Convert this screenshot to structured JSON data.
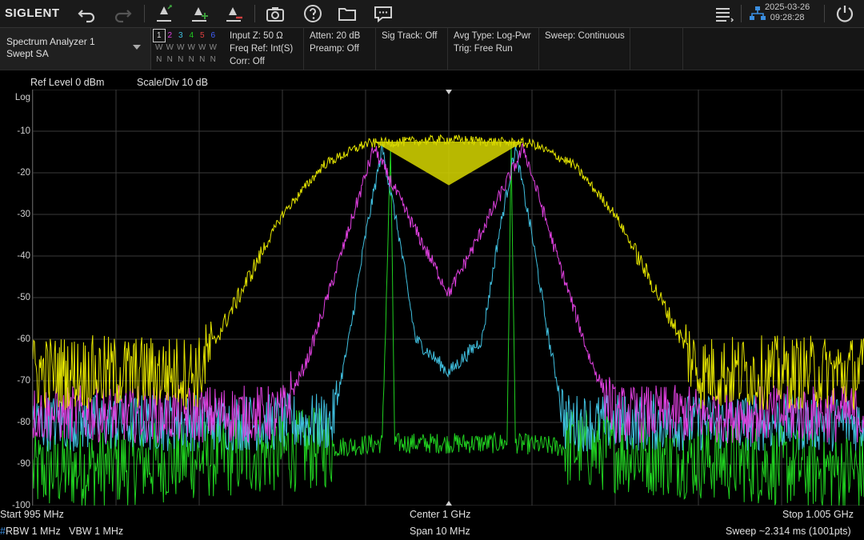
{
  "brand": "SIGLENT",
  "datetime": {
    "date": "2025-03-26",
    "time": "09:28:28"
  },
  "toolbar": {
    "icons": [
      "undo-icon",
      "redo-icon",
      "peak-marker-icon",
      "marker-add-icon",
      "marker-delete-icon",
      "screenshot-icon",
      "help-icon",
      "folder-icon",
      "message-icon",
      "menu-list-icon",
      "network-icon",
      "power-icon"
    ]
  },
  "mode": {
    "name": "Spectrum Analyzer 1",
    "sub": "Swept SA"
  },
  "traces": {
    "numbers": [
      "1",
      "2",
      "3",
      "4",
      "5",
      "6"
    ],
    "types": [
      "W",
      "W",
      "W",
      "W",
      "W",
      "W"
    ],
    "detectors": [
      "N",
      "N",
      "N",
      "N",
      "N",
      "N"
    ],
    "colors": [
      "#e5e500",
      "#e040e0",
      "#40c0e0",
      "#20d020",
      "#e04040",
      "#4060ff"
    ]
  },
  "info": {
    "input_z": "Input Z: 50 Ω",
    "freq_ref": "Freq Ref: Int(S)",
    "corr": "Corr: Off",
    "atten": "Atten: 20 dB",
    "preamp": "Preamp: Off",
    "sig_track": "Sig Track: Off",
    "avg_type": "Avg Type: Log-Pwr",
    "trig": "Trig: Free Run",
    "sweep_mode": "Sweep: Continuous"
  },
  "plot_header": {
    "ref_level": "Ref Level  0 dBm",
    "scale": "Scale/Div  10 dB"
  },
  "y_axis": {
    "scale_label": "Log",
    "ticks": [
      "-10",
      "-20",
      "-30",
      "-40",
      "-50",
      "-60",
      "-70",
      "-80",
      "-90",
      "-100"
    ]
  },
  "footer": {
    "start": "Start  995 MHz",
    "center": "Center  1 GHz",
    "stop": "Stop  1.005 GHz",
    "rbw": "RBW  1 MHz",
    "vbw": "VBW  1 MHz",
    "span": "Span  10 MHz",
    "sweep": "Sweep  ~2.314 ms (1001pts)"
  },
  "chart_data": {
    "type": "line",
    "xlabel": "",
    "ylabel": "",
    "x_range_mhz": [
      995,
      1005
    ],
    "ylim": [
      -100,
      0
    ],
    "series": [
      {
        "color": "#e5e500",
        "description_points": [
          [
            995,
            -68
          ],
          [
            997,
            -68
          ],
          [
            997.2,
            -60
          ],
          [
            997.6,
            -45
          ],
          [
            998.0,
            -30
          ],
          [
            998.5,
            -18
          ],
          [
            999.0,
            -13
          ],
          [
            1000,
            -12
          ],
          [
            1001,
            -13
          ],
          [
            1001.5,
            -18
          ],
          [
            1002.0,
            -30
          ],
          [
            1002.4,
            -45
          ],
          [
            1002.8,
            -60
          ],
          [
            1003,
            -68
          ],
          [
            1005,
            -68
          ]
        ]
      },
      {
        "color": "#e040e0",
        "description_points": [
          [
            995,
            -78
          ],
          [
            998,
            -78
          ],
          [
            998.3,
            -65
          ],
          [
            998.7,
            -40
          ],
          [
            999.1,
            -14
          ],
          [
            999.5,
            -30
          ],
          [
            1000,
            -49
          ],
          [
            1000.5,
            -30
          ],
          [
            1000.9,
            -14
          ],
          [
            1001.3,
            -40
          ],
          [
            1001.7,
            -65
          ],
          [
            1002,
            -78
          ],
          [
            1005,
            -78
          ]
        ]
      },
      {
        "color": "#40c0e0",
        "description_points": [
          [
            995,
            -80
          ],
          [
            998.6,
            -80
          ],
          [
            998.8,
            -60
          ],
          [
            999.0,
            -35
          ],
          [
            999.2,
            -14
          ],
          [
            999.4,
            -35
          ],
          [
            999.6,
            -60
          ],
          [
            1000,
            -68
          ],
          [
            1000.4,
            -60
          ],
          [
            1000.6,
            -35
          ],
          [
            1000.8,
            -14
          ],
          [
            1001.0,
            -35
          ],
          [
            1001.2,
            -60
          ],
          [
            1001.4,
            -80
          ],
          [
            1005,
            -80
          ]
        ]
      },
      {
        "color": "#20d020",
        "description_points": [
          [
            995,
            -92
          ],
          [
            999.2,
            -85
          ],
          [
            999.3,
            -14
          ],
          [
            999.35,
            -85
          ],
          [
            1000,
            -85
          ],
          [
            1000.7,
            -85
          ],
          [
            1000.75,
            -14
          ],
          [
            1000.8,
            -85
          ],
          [
            1005,
            -92
          ]
        ]
      }
    ]
  }
}
